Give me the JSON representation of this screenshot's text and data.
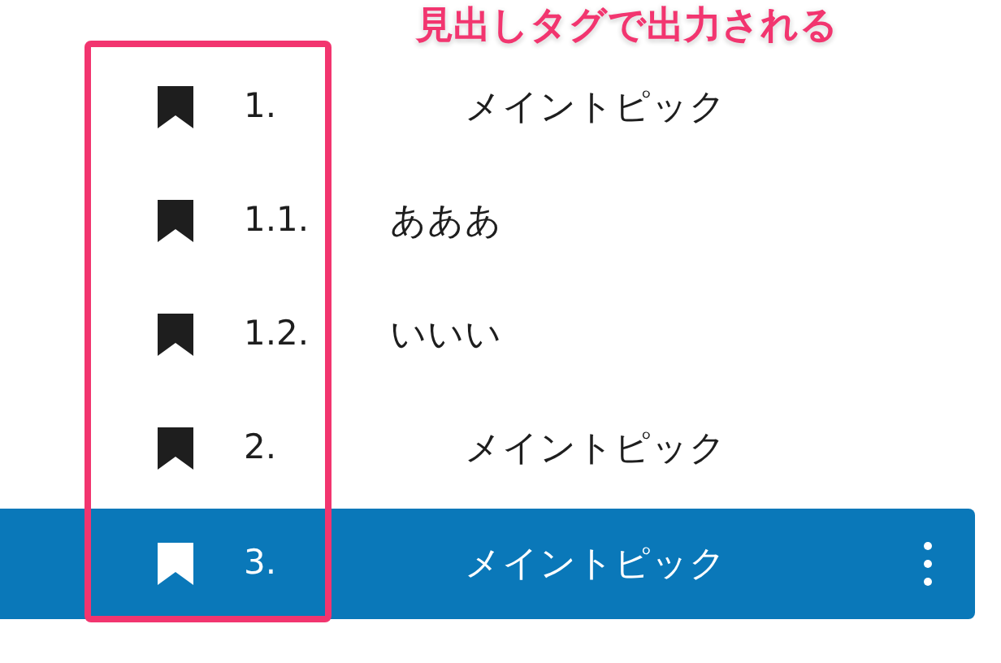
{
  "annotation": {
    "label": "見出しタグで出力される"
  },
  "headings": [
    {
      "number": "1.",
      "title": "メイントピック",
      "selected": false,
      "children": [
        {
          "number": "1.1.",
          "title": "あああ",
          "selected": false
        },
        {
          "number": "1.2.",
          "title": "いいい",
          "selected": false
        }
      ]
    },
    {
      "number": "2.",
      "title": "メイントピック",
      "selected": false
    },
    {
      "number": "3.",
      "title": "メイントピック",
      "selected": true
    }
  ]
}
